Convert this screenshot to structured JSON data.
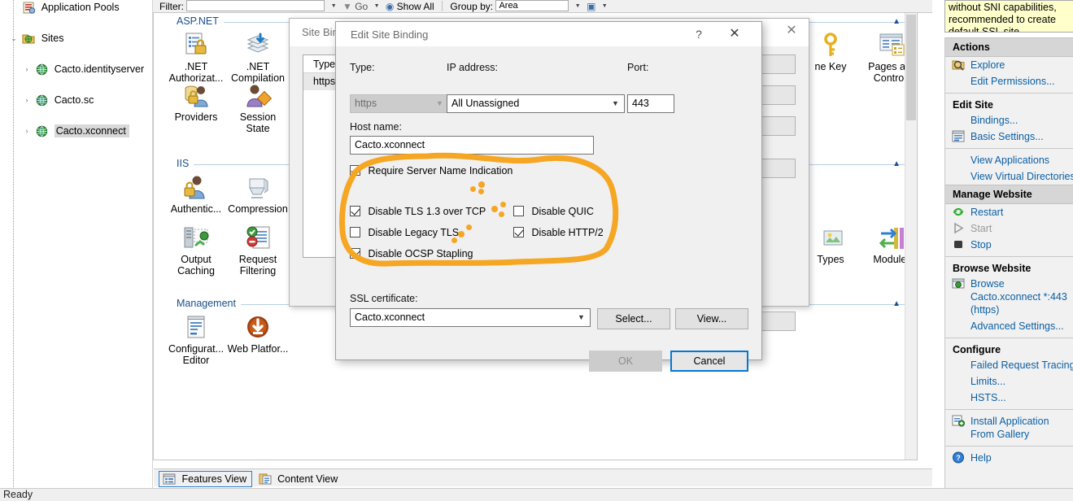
{
  "app": {
    "status_text": "Ready"
  },
  "tree": {
    "items": [
      {
        "label": "Application Pools",
        "icon": "app-pools-icon",
        "indent": 1,
        "expander": "",
        "selected": false
      },
      {
        "label": "Sites",
        "icon": "sites-folder-icon",
        "indent": 1,
        "expander": "⌄",
        "selected": false
      },
      {
        "label": "Cacto.identityserver",
        "icon": "website-globe-icon",
        "indent": 2,
        "expander": "›",
        "selected": false
      },
      {
        "label": "Cacto.sc",
        "icon": "website-globe-icon",
        "indent": 2,
        "expander": "›",
        "selected": false
      },
      {
        "label": "Cacto.xconnect",
        "icon": "website-globe-icon",
        "indent": 2,
        "expander": "›",
        "selected": true
      }
    ]
  },
  "toolbar": {
    "filter_label": "Filter:",
    "filter_value": "",
    "go_label": "Go",
    "show_all_label": "Show All",
    "group_by_label": "Group by:",
    "group_by_value": "Area"
  },
  "features": {
    "groups": [
      {
        "title": "ASP.NET",
        "items": [
          {
            "label": ".NET Authorizat...",
            "icon": "net-authorization-icon"
          },
          {
            "label": ".NET Compilation",
            "icon": "net-compilation-icon"
          },
          {
            "label": "Providers",
            "icon": "providers-icon"
          },
          {
            "label": "Session State",
            "icon": "session-state-icon"
          },
          {
            "label": "ne Key",
            "icon": "machine-key-icon"
          },
          {
            "label": "Pages and Controls",
            "icon": "pages-and-controls-icon"
          }
        ]
      },
      {
        "title": "IIS",
        "items": [
          {
            "label": "Authentic...",
            "icon": "authentication-icon"
          },
          {
            "label": "Compression",
            "icon": "compression-icon"
          },
          {
            "label": "Output Caching",
            "icon": "output-caching-icon"
          },
          {
            "label": "Request Filtering",
            "icon": "request-filtering-icon"
          },
          {
            "label": "Types",
            "icon": "mime-types-icon"
          },
          {
            "label": "Modules",
            "icon": "modules-icon"
          }
        ]
      },
      {
        "title": "Management",
        "items": [
          {
            "label": "Configurat... Editor",
            "icon": "configuration-editor-icon"
          },
          {
            "label": "Web Platfor...",
            "icon": "web-platform-installer-icon"
          }
        ]
      }
    ]
  },
  "site_bindings_dialog": {
    "title": "Site Bindi",
    "close_icon": "close-icon",
    "column_type": "Type",
    "row_type": "https"
  },
  "edit_binding_dialog": {
    "title": "Edit Site Binding",
    "help_icon": "help-question-icon",
    "close_icon": "close-icon",
    "type_label": "Type:",
    "type_value": "https",
    "ip_label": "IP address:",
    "ip_value": "All Unassigned",
    "port_label": "Port:",
    "port_value": "443",
    "host_label": "Host name:",
    "host_value": "Cacto.xconnect",
    "sni_label": "Require Server Name Indication",
    "sni_checked": true,
    "options": [
      {
        "label": "Disable TLS 1.3 over TCP",
        "checked": true
      },
      {
        "label": "Disable QUIC",
        "checked": false
      },
      {
        "label": "Disable Legacy TLS",
        "checked": false
      },
      {
        "label": "Disable HTTP/2",
        "checked": true
      },
      {
        "label": "Disable OCSP Stapling",
        "checked": true
      }
    ],
    "ssl_label": "SSL certificate:",
    "ssl_value": "Cacto.xconnect",
    "select_label": "Select...",
    "view_label": "View...",
    "ok_label": "OK",
    "ok_enabled": false,
    "cancel_label": "Cancel"
  },
  "alert": {
    "line1": "without SNI capabilities,",
    "line2": "recommended to create",
    "line3": "default SSL site."
  },
  "actions": {
    "header": "Actions",
    "items": [
      {
        "label": "Explore",
        "type": "link",
        "icon": "explore-icon"
      },
      {
        "label": "Edit Permissions...",
        "type": "link",
        "icon": ""
      },
      {
        "type": "divider"
      },
      {
        "label": "Edit Site",
        "type": "heading"
      },
      {
        "label": "Bindings...",
        "type": "link",
        "icon": ""
      },
      {
        "label": "Basic Settings...",
        "type": "link",
        "icon": "basic-settings-icon"
      },
      {
        "type": "divider"
      },
      {
        "label": "View Applications",
        "type": "link",
        "icon": ""
      },
      {
        "label": "View Virtual Directories",
        "type": "link",
        "icon": ""
      },
      {
        "type": "divider"
      },
      {
        "label": "Manage Website",
        "type": "header"
      },
      {
        "label": "Restart",
        "type": "link",
        "icon": "restart-icon"
      },
      {
        "label": "Start",
        "type": "link-disabled",
        "icon": "start-icon"
      },
      {
        "label": "Stop",
        "type": "link",
        "icon": "stop-icon"
      },
      {
        "type": "divider"
      },
      {
        "label": "Browse Website",
        "type": "heading"
      },
      {
        "label": "Browse Cacto.xconnect *:443 (https)",
        "type": "link-wrap",
        "icon": "browse-icon"
      },
      {
        "label": "Advanced Settings...",
        "type": "link",
        "icon": ""
      },
      {
        "type": "divider"
      },
      {
        "label": "Configure",
        "type": "heading"
      },
      {
        "label": "Failed Request Tracing...",
        "type": "link",
        "icon": ""
      },
      {
        "label": "Limits...",
        "type": "link",
        "icon": ""
      },
      {
        "label": "HSTS...",
        "type": "link",
        "icon": ""
      },
      {
        "type": "divider"
      },
      {
        "label": "Install Application From Gallery",
        "type": "link-wrap",
        "icon": "install-app-icon"
      },
      {
        "type": "divider"
      },
      {
        "label": "Help",
        "type": "link",
        "icon": "help-icon"
      }
    ]
  },
  "view_tabs": [
    {
      "label": "Features View",
      "active": true,
      "icon": "features-view-icon"
    },
    {
      "label": "Content View",
      "active": false,
      "icon": "content-view-icon"
    }
  ],
  "colors": {
    "annotation": "#f5a623",
    "link": "#0b5fa5",
    "group_title": "#1a4f8a",
    "focus": "#0078d7",
    "alert_bg": "#ffffcc"
  }
}
